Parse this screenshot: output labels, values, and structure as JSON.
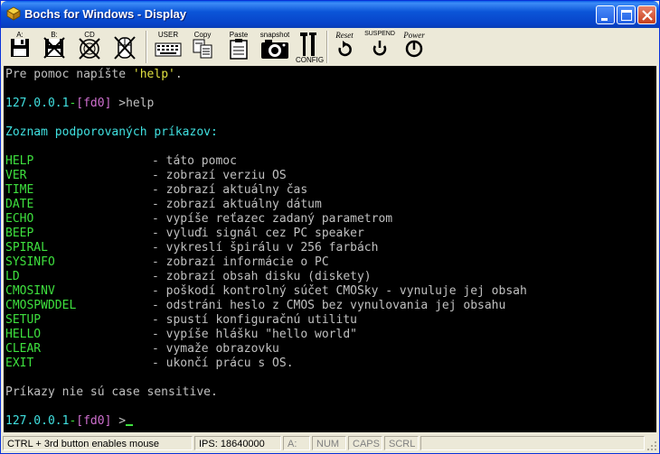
{
  "window": {
    "title": "Bochs for Windows - Display"
  },
  "toolbar": {
    "floppy_a": "A:",
    "floppy_b": "B:",
    "cdrom": "CD",
    "user": "USER",
    "copy": "Copy",
    "paste": "Paste",
    "snapshot": "snapshot",
    "config": "CONFIG",
    "reset": "Reset",
    "suspend": "SUSPEND",
    "power": "Power"
  },
  "console": {
    "help_hint_pre": "Pre pomoc napíšte ",
    "help_hint_cmd": "'help'",
    "help_hint_post": ".",
    "prompt1_host": "127.0.0.1",
    "prompt1_dash": "-",
    "prompt1_drive": "[fd0]",
    "prompt1_arrow": " >",
    "prompt1_cmd": "help",
    "list_header": "Zoznam podporovaných príkazov:",
    "commands": [
      {
        "name": "HELP",
        "desc": "- táto pomoc"
      },
      {
        "name": "VER",
        "desc": "- zobrazí verziu OS"
      },
      {
        "name": "TIME",
        "desc": "- zobrazí aktuálny čas"
      },
      {
        "name": "DATE",
        "desc": "- zobrazí aktuálny dátum"
      },
      {
        "name": "ECHO",
        "desc": "- vypíše reťazec zadaný parametrom"
      },
      {
        "name": "BEEP",
        "desc": "- vyluďi signál cez PC speaker"
      },
      {
        "name": "SPIRAL",
        "desc": "- vykreslí špirálu v 256 farbách"
      },
      {
        "name": "SYSINFO",
        "desc": "- zobrazí informácie o PC"
      },
      {
        "name": "LD",
        "desc": "- zobrazí obsah disku (diskety)"
      },
      {
        "name": "CMOSINV",
        "desc": "- poškodí kontrolný súčet CMOSky - vynuluje jej obsah"
      },
      {
        "name": "CMOSPWDDEL",
        "desc": "- odstráni heslo z CMOS bez vynulovania jej obsahu"
      },
      {
        "name": "SETUP",
        "desc": "- spustí konfiguračnú utilitu"
      },
      {
        "name": "HELLO",
        "desc": "- vypíše hlášku \"hello world\""
      },
      {
        "name": "CLEAR",
        "desc": "- vymaže obrazovku"
      },
      {
        "name": "EXIT",
        "desc": "- ukončí prácu s OS."
      }
    ],
    "case_note": "Príkazy nie sú case sensitive.",
    "prompt2_host": "127.0.0.1",
    "prompt2_dash": "-",
    "prompt2_drive": "[fd0]",
    "prompt2_arrow": " >"
  },
  "status": {
    "mouse_hint": "CTRL + 3rd button enables mouse",
    "ips": "IPS: 18640000",
    "drive": "A:",
    "num": "NUM",
    "caps": "CAPS",
    "scrl": "SCRL"
  },
  "colors": {
    "title_bar": "#0b55d8",
    "console_bg": "#000000",
    "console_green": "#3ee03e",
    "console_cyan": "#40e0e0"
  }
}
